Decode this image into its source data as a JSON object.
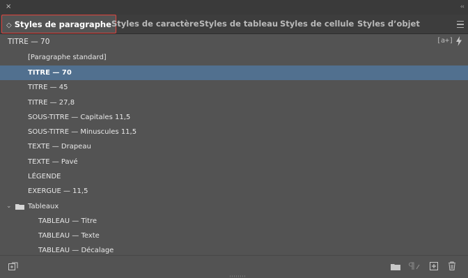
{
  "panel": {
    "close_symbol": "×",
    "collapse_symbol": "‹‹",
    "tabs": [
      {
        "label": "Styles de paragraphe",
        "active": true
      },
      {
        "label": "Styles de caractère",
        "active": false
      },
      {
        "label": "Styles de tableau",
        "active": false
      },
      {
        "label": "Styles de cellule",
        "active": false
      },
      {
        "label": "Styles d’objet",
        "active": false
      }
    ],
    "active_tab_marker": "◇",
    "menu_icon": "hamburger-menu-icon"
  },
  "header": {
    "current_style": "TITRE — 70",
    "clear_overrides_label": "[a+]",
    "quick_apply_icon": "lightning-icon"
  },
  "styles": [
    {
      "label": "[Paragraphe standard]",
      "level": 1,
      "selected": false
    },
    {
      "label": "TITRE — 70",
      "level": 1,
      "selected": true
    },
    {
      "label": "TITRE — 45",
      "level": 1,
      "selected": false
    },
    {
      "label": "TITRE — 27,8",
      "level": 1,
      "selected": false
    },
    {
      "label": "SOUS-TITRE — Capitales 11,5",
      "level": 1,
      "selected": false
    },
    {
      "label": "SOUS-TITRE — Minuscules 11,5",
      "level": 1,
      "selected": false
    },
    {
      "label": "TEXTE — Drapeau",
      "level": 1,
      "selected": false
    },
    {
      "label": "TEXTE — Pavé",
      "level": 1,
      "selected": false
    },
    {
      "label": "LÉGENDE",
      "level": 1,
      "selected": false
    },
    {
      "label": "EXERGUE — 11,5",
      "level": 1,
      "selected": false
    },
    {
      "label": "Tableaux",
      "level": 0,
      "group": true,
      "expanded": true,
      "selected": false
    },
    {
      "label": "TABLEAU — Titre",
      "level": 2,
      "selected": false
    },
    {
      "label": "TABLEAU — Texte",
      "level": 2,
      "selected": false
    },
    {
      "label": "TABLEAU — Décalage",
      "level": 2,
      "selected": false
    }
  ],
  "footer": {
    "left_icon": "load-styles-icon",
    "right_icons": [
      "new-group-folder-icon",
      "clear-overrides-icon",
      "new-style-icon",
      "delete-trash-icon"
    ]
  },
  "colors": {
    "panel_bg": "#535353",
    "selection": "#51708f",
    "active_tab_outline": "#e0443e"
  }
}
